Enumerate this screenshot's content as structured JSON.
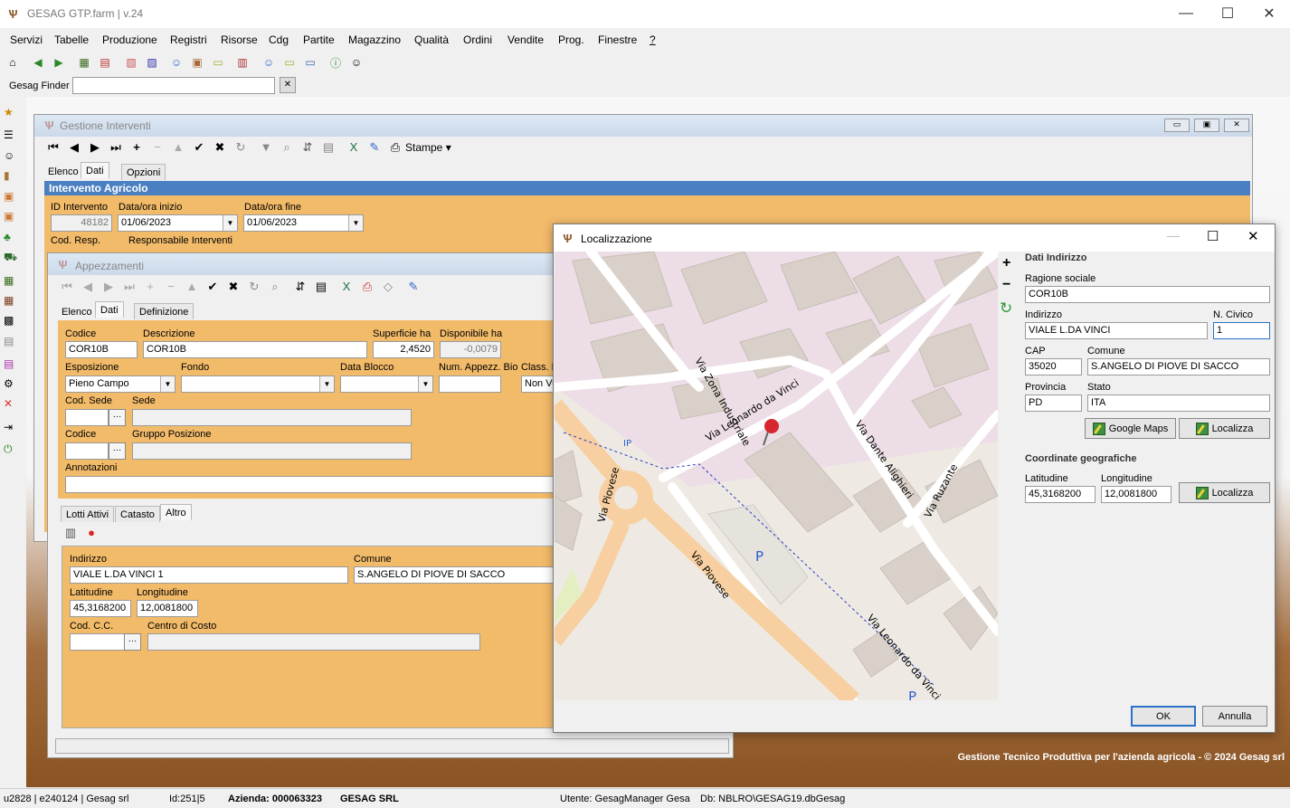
{
  "app": {
    "title": "GESAG GTP.farm | v.24"
  },
  "menu": [
    "Servizi",
    "Tabelle",
    "Produzione",
    "Registri",
    "Risorse",
    "Cdg",
    "Partite",
    "Magazzino",
    "Qualità",
    "Ordini",
    "Vendite",
    "Prog.",
    "Finestre",
    "?"
  ],
  "finder": {
    "label": "Gesag Finder",
    "value": ""
  },
  "interventi": {
    "title": "Gestione Interventi",
    "stampe": "Stampe",
    "tabs": [
      "Elenco",
      "Dati",
      "Opzioni"
    ],
    "section": "Intervento Agricolo",
    "id_label": "ID Intervento",
    "id_value": "48182",
    "start_label": "Data/ora inizio",
    "start_value": "01/06/2023",
    "end_label": "Data/ora fine",
    "end_value": "01/06/2023",
    "resp_code_label": "Cod. Resp.",
    "resp_label": "Responsabile Interventi"
  },
  "appezzamenti": {
    "title": "Appezzamenti",
    "tabs": [
      "Elenco",
      "Dati",
      "Definizione"
    ],
    "codice_label": "Codice",
    "codice": "COR10B",
    "descr_label": "Descrizione",
    "descr": "COR10B",
    "sup_label": "Superficie ha",
    "sup": "2,4520",
    "disp_label": "Disponibile ha",
    "disp": "-0,0079",
    "espo_label": "Esposizione",
    "espo": "Pieno Campo",
    "fondo_label": "Fondo",
    "fondo": "",
    "blocco_label": "Data Blocco",
    "blocco": "",
    "num_label": "Num. Appezz. Bio",
    "num": "",
    "class_label": "Class. D",
    "class": "Non Vu",
    "codsede_label": "Cod. Sede",
    "sede_label": "Sede",
    "codice2_label": "Codice",
    "gruppo_label": "Gruppo Posizione",
    "note_label": "Annotazioni",
    "subtabs": [
      "Lotti Attivi",
      "Catasto",
      "Altro"
    ],
    "ind_label": "Indirizzo",
    "ind": "VIALE L.DA VINCI 1",
    "com_label": "Comune",
    "com": "S.ANGELO DI PIOVE DI SACCO",
    "lat_label": "Latitudine",
    "lat": "45,3168200",
    "lon_label": "Longitudine",
    "lon": "12,0081800",
    "cc_label": "Cod. C.C.",
    "centro_label": "Centro di Costo"
  },
  "loc": {
    "title": "Localizzazione",
    "section": "Dati Indirizzo",
    "rag_label": "Ragione sociale",
    "rag": "COR10B",
    "ind_label": "Indirizzo",
    "ind": "VIALE L.DA VINCI",
    "civ_label": "N. Civico",
    "civ": "1",
    "cap_label": "CAP",
    "cap": "35020",
    "com_label": "Comune",
    "com": "S.ANGELO DI PIOVE DI SACCO",
    "prov_label": "Provincia",
    "prov": "PD",
    "stato_label": "Stato",
    "stato": "ITA",
    "gmaps": "Google Maps",
    "localizza": "Localizza",
    "coord_section": "Coordinate geografiche",
    "lat_label": "Latitudine",
    "lat": "45,3168200",
    "lon_label": "Longitudine",
    "lon": "12,0081800",
    "ok": "OK",
    "annulla": "Annulla",
    "map": {
      "streets": [
        "Via Zona Industriale",
        "Via Leonardo da Vinci",
        "Via Dante Alighieri",
        "Via Ruzante",
        "Via Piovese",
        "Via Piovese",
        "Via Leonardo da Vinci"
      ],
      "poi": [
        "IP",
        "P",
        "P"
      ]
    }
  },
  "credit": "Gestione Tecnico Produttiva per l'azienda agricola - © 2024 Gesag srl",
  "status": [
    "u2828 | e240124 | Gesag srl",
    "Id:251|5",
    "Azienda: 000063323",
    "GESAG SRL",
    "Utente: GesagManager Gesa",
    "Db: NBLRO\\GESAG19.dbGesag"
  ]
}
